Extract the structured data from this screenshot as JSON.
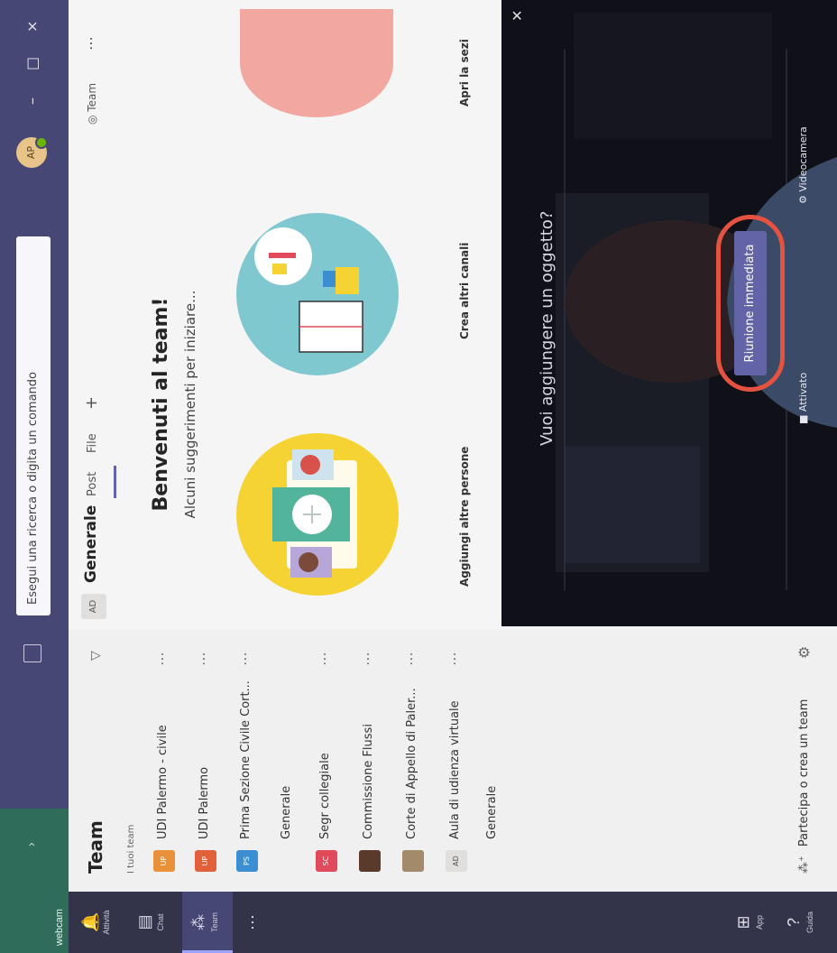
{
  "window": {
    "webcam_label": "webcam",
    "search_placeholder": "Esegui una ricerca o digita un comando",
    "user_initials": "AP",
    "minimize": "–",
    "maximize": "□",
    "close": "×"
  },
  "appbar": [
    {
      "label": "Attività",
      "icon": "bell-icon",
      "glyph": "🔔"
    },
    {
      "label": "Chat",
      "icon": "chat-icon",
      "glyph": "▤"
    },
    {
      "label": "Team",
      "icon": "teams-icon",
      "glyph": "⁂"
    },
    {
      "label": "",
      "icon": "more-apps-icon",
      "glyph": "⋯"
    },
    {
      "label": "App",
      "icon": "apps-icon",
      "glyph": "⊞"
    },
    {
      "label": "Guida",
      "icon": "help-icon",
      "glyph": "?"
    }
  ],
  "teams_panel": {
    "title": "Team",
    "section_label": "I tuoi team",
    "teams": [
      {
        "name": "UDI Palermo - civile",
        "tile": "UP",
        "color": "#e8913a"
      },
      {
        "name": "UDI Palermo",
        "tile": "UP",
        "color": "#e2603a"
      },
      {
        "name": "Prima Sezione Civile Cort...",
        "tile": "PS",
        "color": "#3a8ed1"
      },
      {
        "name": "Segr collegiale",
        "tile": "SC",
        "color": "#e04a5a"
      },
      {
        "name": "Commissione Flussi",
        "tile": "",
        "color": "#5a3a2a"
      },
      {
        "name": "Corte di Appello di Paler...",
        "tile": "",
        "color": "#a28a6a"
      },
      {
        "name": "Aula di udienza virtuale",
        "tile": "AD",
        "color": "#e1dfdd"
      }
    ],
    "channel_general": "Generale",
    "channel_general2": "Generale",
    "join_label": "Partecipa o crea un team"
  },
  "main": {
    "channel_avatar": "AD",
    "channel_name": "Generale",
    "tabs": [
      "Post",
      "File"
    ],
    "team_link": "Team",
    "welcome": "Benvenuti al team!",
    "suggest": "Alcuni suggerimenti per iniziare...",
    "cards": [
      "Aggiungi altre persone",
      "Crea altri canali",
      "Apri la sezi"
    ]
  },
  "overlay": {
    "question": "Vuoi aggiungere un oggetto?",
    "meet_button": "Riunione immediata",
    "toggle_label": "Attivato",
    "camera_label": "Videocamera"
  },
  "colors": {
    "titlebar": "#464775",
    "accent": "#6264a7",
    "highlight_ring": "#e55340"
  }
}
